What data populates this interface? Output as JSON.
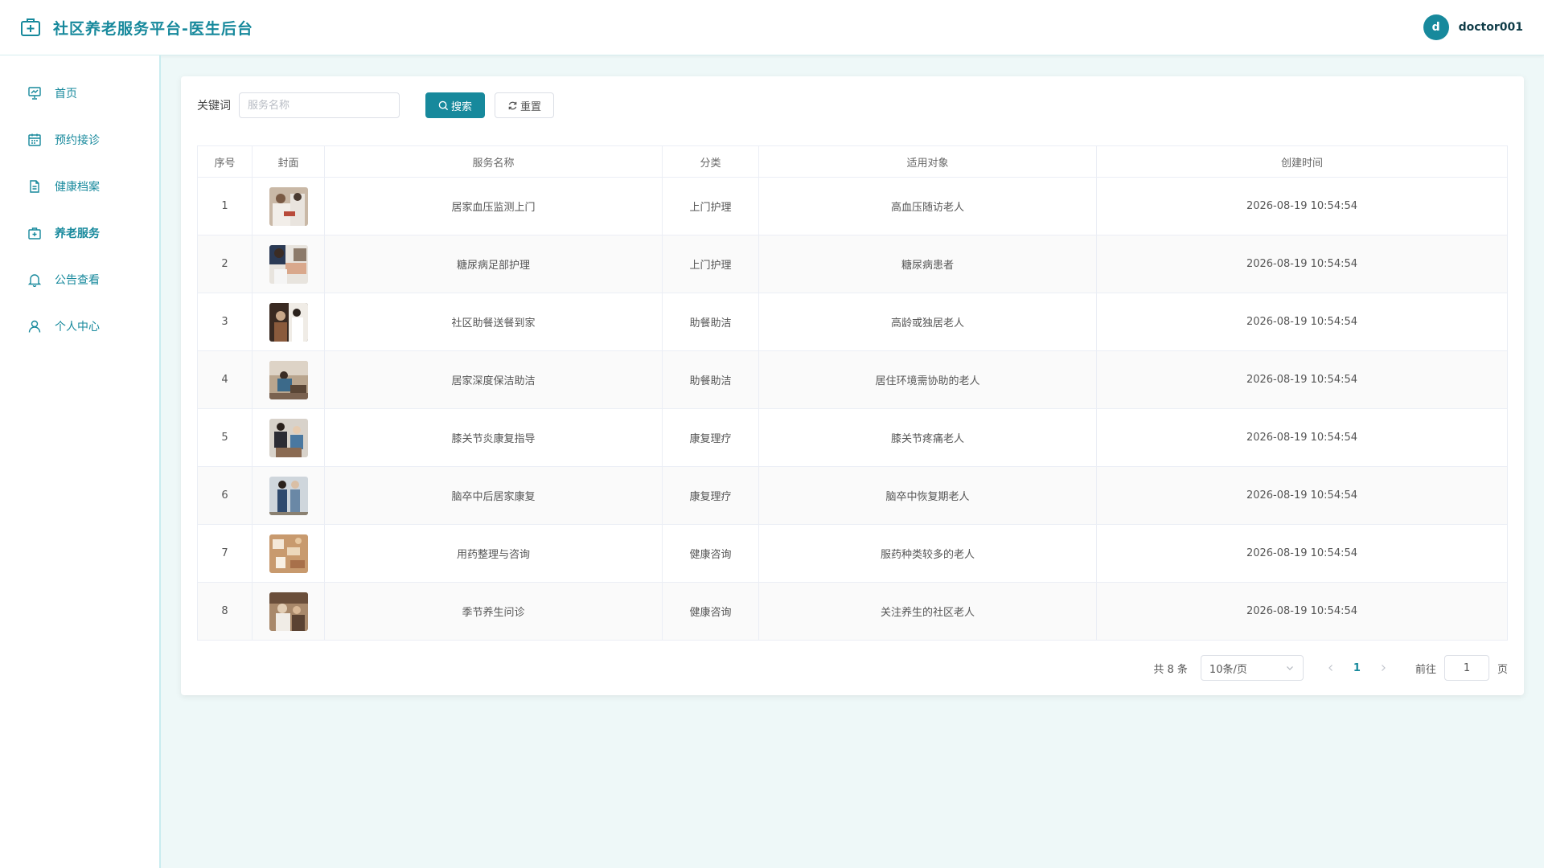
{
  "app": {
    "title": "社区养老服务平台-医生后台",
    "user_initial": "d",
    "username": "doctor001",
    "accent_color": "#17899c"
  },
  "sidebar": {
    "items": [
      {
        "label": "首页",
        "icon": "chart-board-icon"
      },
      {
        "label": "预约接诊",
        "icon": "calendar-icon"
      },
      {
        "label": "健康档案",
        "icon": "document-icon"
      },
      {
        "label": "养老服务",
        "icon": "medical-kit-icon",
        "active": true
      },
      {
        "label": "公告查看",
        "icon": "bell-icon"
      },
      {
        "label": "个人中心",
        "icon": "user-icon"
      }
    ]
  },
  "search": {
    "label": "关键词",
    "placeholder": "服务名称",
    "value": "",
    "search_label": "搜索",
    "reset_label": "重置"
  },
  "table": {
    "headers": [
      "序号",
      "封面",
      "服务名称",
      "分类",
      "适用对象",
      "创建时间"
    ],
    "rows": [
      {
        "index": "1",
        "name": "居家血压监测上门",
        "category": "上门护理",
        "target": "高血压随访老人",
        "created": "2026-08-19 10:54:54"
      },
      {
        "index": "2",
        "name": "糖尿病足部护理",
        "category": "上门护理",
        "target": "糖尿病患者",
        "created": "2026-08-19 10:54:54"
      },
      {
        "index": "3",
        "name": "社区助餐送餐到家",
        "category": "助餐助洁",
        "target": "高龄或独居老人",
        "created": "2026-08-19 10:54:54"
      },
      {
        "index": "4",
        "name": "居家深度保洁助洁",
        "category": "助餐助洁",
        "target": "居住环境需协助的老人",
        "created": "2026-08-19 10:54:54"
      },
      {
        "index": "5",
        "name": "膝关节炎康复指导",
        "category": "康复理疗",
        "target": "膝关节疼痛老人",
        "created": "2026-08-19 10:54:54"
      },
      {
        "index": "6",
        "name": "脑卒中后居家康复",
        "category": "康复理疗",
        "target": "脑卒中恢复期老人",
        "created": "2026-08-19 10:54:54"
      },
      {
        "index": "7",
        "name": "用药整理与咨询",
        "category": "健康咨询",
        "target": "服药种类较多的老人",
        "created": "2026-08-19 10:54:54"
      },
      {
        "index": "8",
        "name": "季节养生问诊",
        "category": "健康咨询",
        "target": "关注养生的社区老人",
        "created": "2026-08-19 10:54:54"
      }
    ]
  },
  "pagination": {
    "total": "共 8 条",
    "page_size": "10条/页",
    "current_page": "1",
    "goto_label": "前往",
    "goto_value": "1",
    "page_suffix": "页"
  }
}
